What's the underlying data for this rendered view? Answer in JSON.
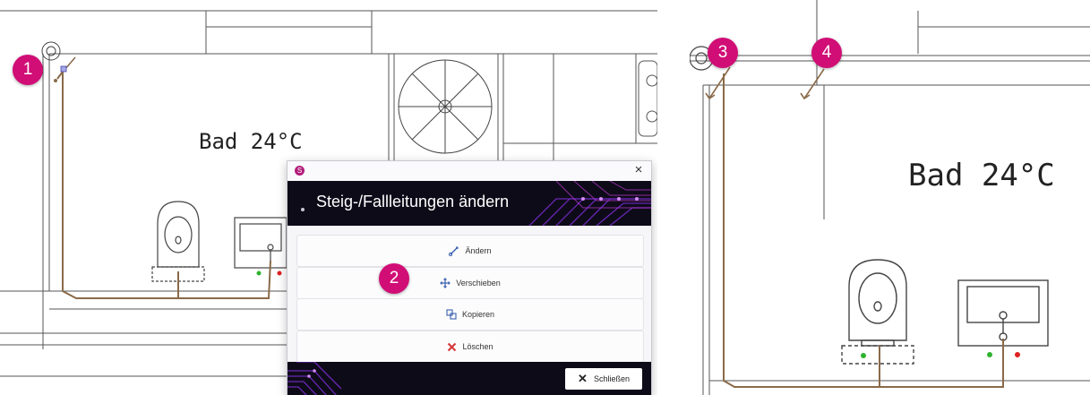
{
  "left_plan": {
    "room_label": "Bad 24°C",
    "markers": [
      {
        "number": "1"
      },
      {
        "number": "2"
      }
    ]
  },
  "dialog": {
    "app_icon": "S",
    "close_glyph": "×",
    "title": "Steig-/Fallleitungen ändern",
    "buttons": [
      {
        "label": "Ändern",
        "icon": "edit-pipe-icon",
        "color": "#3a5fae"
      },
      {
        "label": "Verschieben",
        "icon": "move-icon",
        "color": "#3a5fae"
      },
      {
        "label": "Kopieren",
        "icon": "copy-icon",
        "color": "#3a5fae"
      },
      {
        "label": "Löschen",
        "icon": "delete-icon",
        "color": "#d63a3a"
      }
    ],
    "close_button": {
      "label": "Schließen",
      "icon": "close-x-icon"
    }
  },
  "right_plan": {
    "room_label": "Bad 24°C",
    "markers": [
      {
        "number": "3"
      },
      {
        "number": "4"
      }
    ]
  },
  "colors": {
    "marker": "#d10d76",
    "pipe": "#8a6a48",
    "dialog_header": "#0e0b19",
    "accent_circuit": "#7a2bd1"
  }
}
